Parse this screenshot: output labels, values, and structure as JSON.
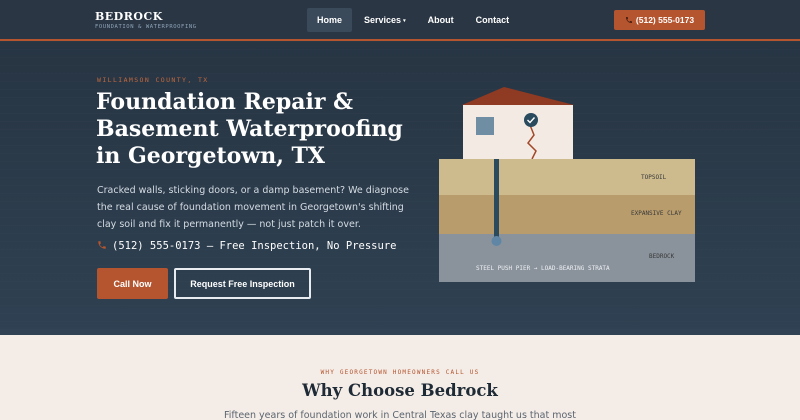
{
  "brand": {
    "name": "BEDROCK",
    "tagline": "FOUNDATION & WATERPROOFING"
  },
  "nav": {
    "items": [
      {
        "label": "Home",
        "active": true
      },
      {
        "label": "Services",
        "has_dropdown": true
      },
      {
        "label": "About"
      },
      {
        "label": "Contact"
      }
    ],
    "dropdown_caret": "▾"
  },
  "header_phone": {
    "icon": "phone-icon",
    "label": "(512) 555-0173"
  },
  "hero": {
    "eyebrow": "WILLIAMSON COUNTY, TX",
    "title": "Foundation Repair & Basement Waterproofing in Georgetown, TX",
    "subtitle": "Cracked walls, sticking doors, or a damp basement? We diagnose the real cause of foundation movement in Georgetown's shifting clay soil and fix it permanently — not just patch it over.",
    "phone_line": "(512) 555-0173 — Free Inspection, No Pressure",
    "primary_button": "Call Now",
    "secondary_button": "Request Free Inspection"
  },
  "illustration": {
    "layers": {
      "topsoil": "TOPSOIL",
      "clay": "EXPANSIVE CLAY",
      "bedrock": "BEDROCK"
    },
    "pier_caption": "STEEL PUSH PIER → LOAD-BEARING STRATA",
    "check_icon": "check-icon"
  },
  "why": {
    "eyebrow": "WHY GEORGETOWN HOMEOWNERS CALL US",
    "title": "Why Choose Bedrock",
    "text": "Fifteen years of foundation work in Central Texas clay taught us that most"
  },
  "colors": {
    "accent": "#b5552f",
    "navy": "#2a3644",
    "cream": "#f4ece6",
    "topsoil": "#cdbb8e",
    "clay": "#b89c6c",
    "bedrock": "#8a929b",
    "pier": "#2a4a5e"
  }
}
